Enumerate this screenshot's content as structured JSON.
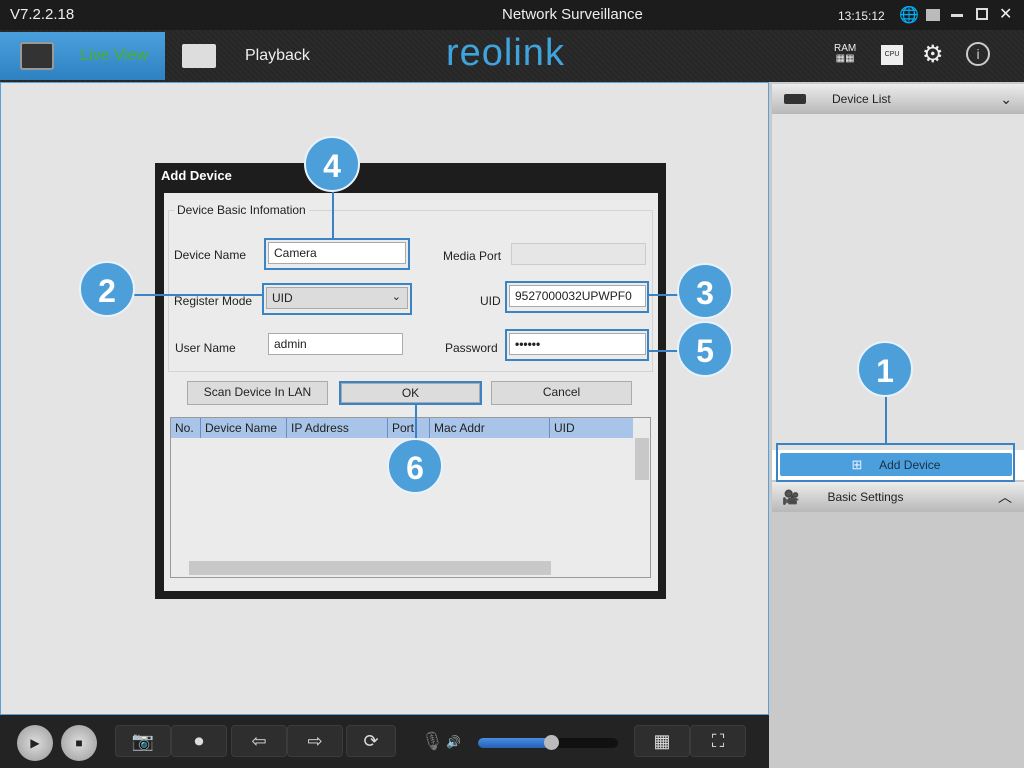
{
  "titlebar": {
    "version": "V7.2.2.18",
    "title": "Network Surveillance",
    "clock": "13:15:12",
    "icons": [
      "globe-icon",
      "lock-icon",
      "minimize-icon",
      "maximize-icon",
      "close-icon"
    ]
  },
  "toolbar": {
    "live_view": "Live View",
    "playback": "Playback",
    "logo": "reolink",
    "right_icons": [
      "ram-icon",
      "cpu-icon",
      "gear-icon",
      "info-icon"
    ],
    "ram_label": "RAM",
    "cpu_label": "CPU"
  },
  "dialog": {
    "title": "Add Device",
    "group": "Device Basic Infomation",
    "device_name_label": "Device Name",
    "device_name": "Camera",
    "media_port_label": "Media Port",
    "media_port": "",
    "register_mode_label": "Register Mode",
    "register_mode": "UID",
    "uid_label": "UID",
    "uid": "9527000032UPWPF0",
    "user_name_label": "User Name",
    "user_name": "admin",
    "password_label": "Password",
    "password": "••••••",
    "scan_button": "Scan Device In LAN",
    "ok_button": "OK",
    "cancel_button": "Cancel",
    "columns": [
      "No.",
      "Device Name",
      "IP Address",
      "Port",
      "Mac Addr",
      "UID"
    ]
  },
  "sidebar": {
    "device_list": "Device List",
    "add_device": "Add Device",
    "basic_settings": "Basic Settings"
  },
  "callouts": [
    "1",
    "2",
    "3",
    "4",
    "5",
    "6"
  ],
  "accent": "#4d9fda",
  "volume": 0.52
}
